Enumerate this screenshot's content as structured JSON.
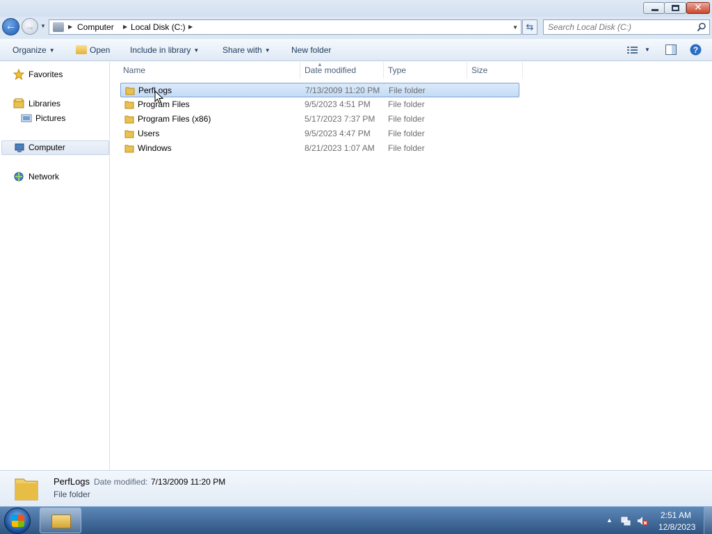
{
  "window": {
    "minimize_label": "",
    "maximize_label": "",
    "close_label": "✕"
  },
  "address": {
    "segments": [
      "Computer",
      "Local Disk (C:)"
    ],
    "search_placeholder": "Search Local Disk (C:)"
  },
  "toolbar": {
    "organize": "Organize",
    "open": "Open",
    "include_in_library": "Include in library",
    "share_with": "Share with",
    "new_folder": "New folder"
  },
  "nav": {
    "favorites": "Favorites",
    "libraries": "Libraries",
    "pictures": "Pictures",
    "computer": "Computer",
    "network": "Network"
  },
  "columns": {
    "name": "Name",
    "date_modified": "Date modified",
    "type": "Type",
    "size": "Size"
  },
  "files": [
    {
      "name": "PerfLogs",
      "date": "7/13/2009 11:20 PM",
      "type": "File folder"
    },
    {
      "name": "Program Files",
      "date": "9/5/2023 4:51 PM",
      "type": "File folder"
    },
    {
      "name": "Program Files (x86)",
      "date": "5/17/2023 7:37 PM",
      "type": "File folder"
    },
    {
      "name": "Users",
      "date": "9/5/2023 4:47 PM",
      "type": "File folder"
    },
    {
      "name": "Windows",
      "date": "8/21/2023 1:07 AM",
      "type": "File folder"
    }
  ],
  "details": {
    "name": "PerfLogs",
    "date_label": "Date modified:",
    "date": "7/13/2009 11:20 PM",
    "type": "File folder"
  },
  "taskbar": {
    "time": "2:51 AM",
    "date": "12/8/2023"
  },
  "icons": {
    "folder_color": "#e8c14f",
    "selection_color": "#cce4f7",
    "accent": "#1e395b"
  }
}
